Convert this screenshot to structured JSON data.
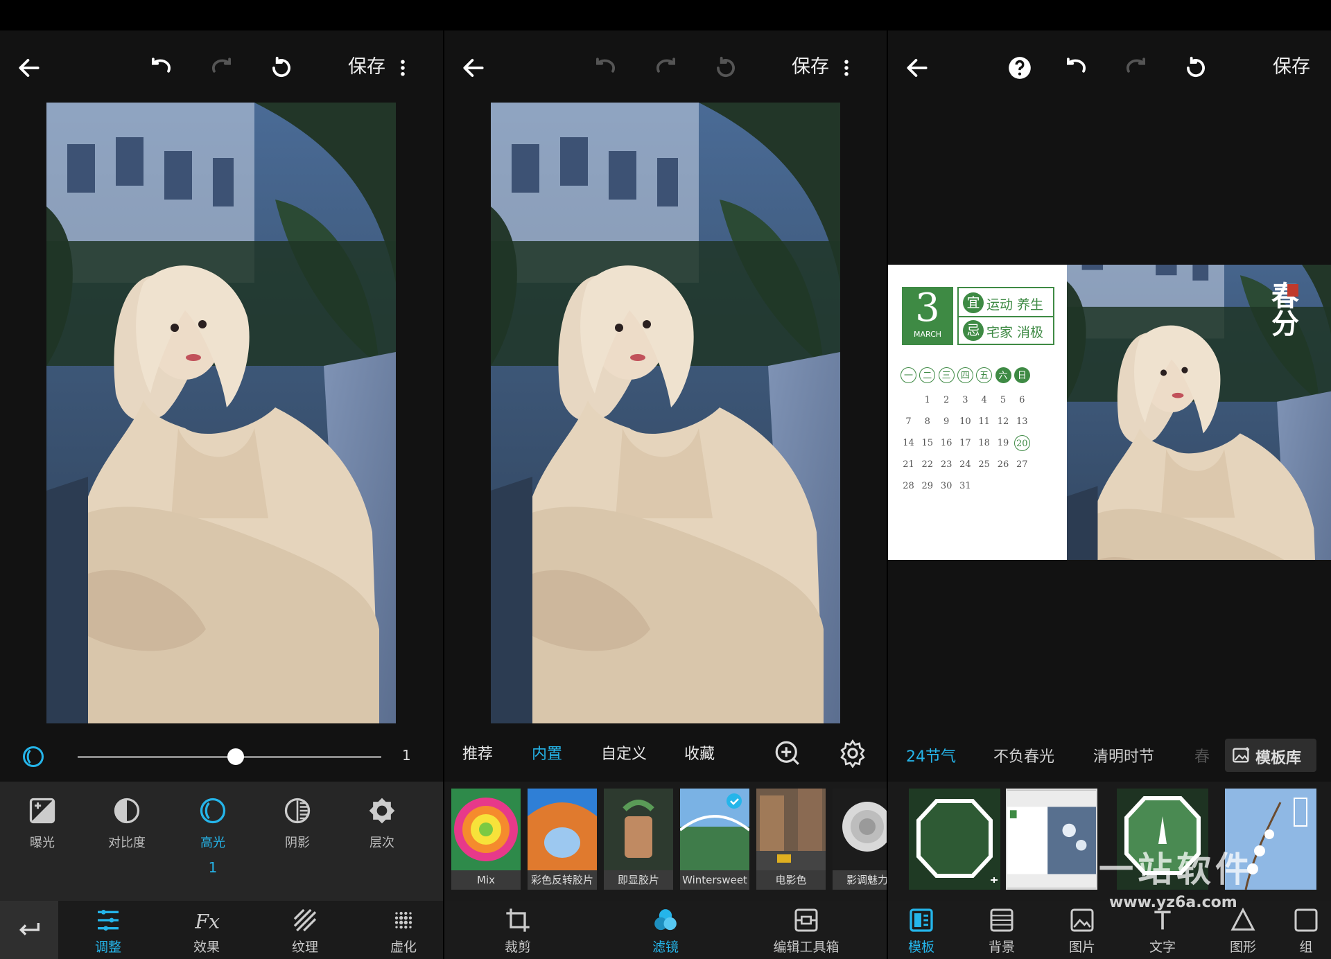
{
  "colors": {
    "accent": "#25b5ea",
    "background": "#121212",
    "toolbar": "#262626",
    "template_green": "#3e8a44"
  },
  "panel1": {
    "save_label": "保存",
    "slider_value": "1",
    "slider_level": 0.52,
    "tools": [
      {
        "label": "曝光",
        "icon": "exposure-icon"
      },
      {
        "label": "对比度",
        "icon": "contrast-icon"
      },
      {
        "label": "高光",
        "icon": "highlight-icon",
        "active": true
      },
      {
        "label": "阴影",
        "icon": "shadow-icon"
      },
      {
        "label": "层次",
        "icon": "structure-icon"
      }
    ],
    "active_tool_value": "1",
    "nav": [
      {
        "label": "调整",
        "icon": "adjust-icon",
        "active": true
      },
      {
        "label": "效果",
        "icon": "fx-icon"
      },
      {
        "label": "纹理",
        "icon": "texture-icon"
      },
      {
        "label": "虚化",
        "icon": "blur-icon"
      }
    ]
  },
  "panel2": {
    "save_label": "保存",
    "tabs": [
      "推荐",
      "内置",
      "自定义",
      "收藏"
    ],
    "active_tab": "内置",
    "filters": [
      "Mix",
      "彩色反转胶片",
      "即显胶片",
      "Wintersweet",
      "电影色",
      "影调魅力"
    ],
    "nav": [
      {
        "label": "裁剪",
        "icon": "crop-icon"
      },
      {
        "label": "滤镜",
        "icon": "filter-icon",
        "active": true
      },
      {
        "label": "编辑工具箱",
        "icon": "toolbox-icon"
      }
    ]
  },
  "panel3": {
    "save_label": "保存",
    "calendar": {
      "month_number": "3",
      "month_name": "MARCH",
      "yi_label": "宜",
      "yi_text": "运动 养生",
      "ji_label": "忌",
      "ji_text": "宅家 消极",
      "weekdays": [
        "一",
        "二",
        "三",
        "四",
        "五",
        "六",
        "日"
      ],
      "rows": [
        [
          "",
          "1",
          "2",
          "3",
          "4",
          "5",
          "6"
        ],
        [
          "7",
          "8",
          "9",
          "10",
          "11",
          "12",
          "13"
        ],
        [
          "14",
          "15",
          "16",
          "17",
          "18",
          "19",
          "20"
        ],
        [
          "21",
          "22",
          "23",
          "24",
          "25",
          "26",
          "27"
        ],
        [
          "28",
          "29",
          "30",
          "31",
          "",
          "",
          ""
        ]
      ],
      "highlight_day": "20",
      "title_calligraphy": "春分"
    },
    "categories": [
      "24节气",
      "不负春光",
      "清明时节",
      "春"
    ],
    "active_category": "24节气",
    "library_button": "模板库",
    "nav": [
      {
        "label": "模板",
        "icon": "template-icon",
        "active": true
      },
      {
        "label": "背景",
        "icon": "background-icon"
      },
      {
        "label": "图片",
        "icon": "image-icon"
      },
      {
        "label": "文字",
        "icon": "text-icon"
      },
      {
        "label": "图形",
        "icon": "shape-icon"
      },
      {
        "label": "组",
        "icon": "group-icon"
      }
    ]
  },
  "watermark": {
    "title": "一站软件",
    "url": "www.yz6a.com"
  }
}
